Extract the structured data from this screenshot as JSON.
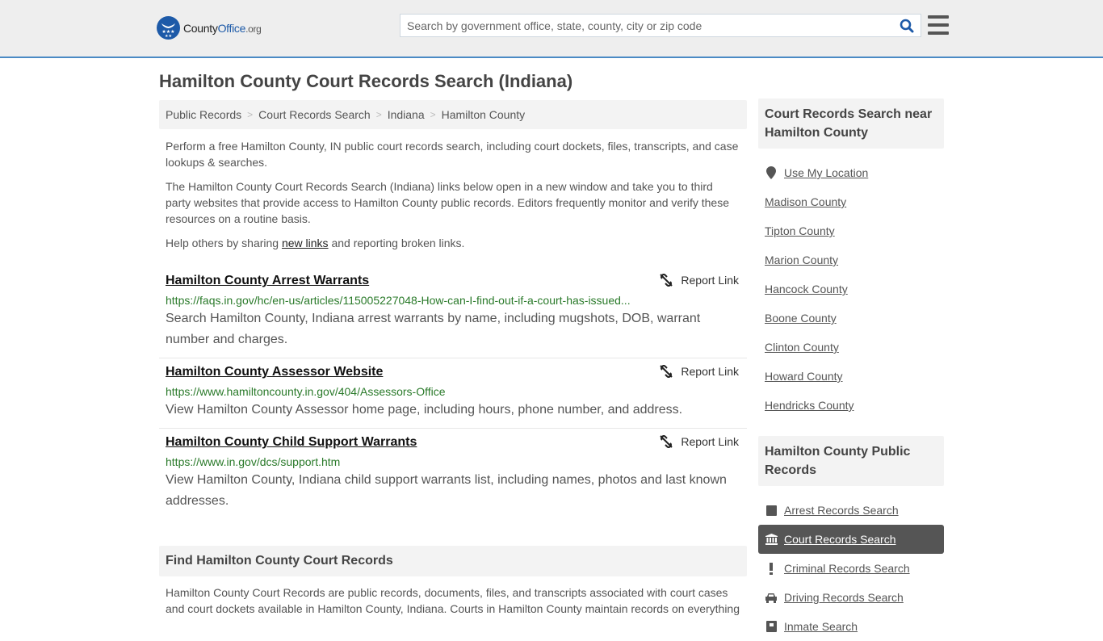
{
  "header": {
    "logo": {
      "name_part1": "County",
      "name_part2": "Office",
      "tld": ".org"
    },
    "search": {
      "placeholder": "Search by government office, state, county, city or zip code",
      "value": ""
    },
    "accent_color": "#1d5aa8"
  },
  "page_title": "Hamilton County Court Records Search (Indiana)",
  "breadcrumb": [
    "Public Records",
    "Court Records Search",
    "Indiana",
    "Hamilton County"
  ],
  "intro": {
    "p1": "Perform a free Hamilton County, IN public court records search, including court dockets, files, transcripts, and case lookups & searches.",
    "p2": "The Hamilton County Court Records Search (Indiana) links below open in a new window and take you to third party websites that provide access to Hamilton County public records. Editors frequently monitor and verify these resources on a routine basis.",
    "p3_before": "Help others by sharing ",
    "p3_link": "new links",
    "p3_after": " and reporting broken links."
  },
  "report_label": "Report Link",
  "links": [
    {
      "title": "Hamilton County Arrest Warrants",
      "url": "https://faqs.in.gov/hc/en-us/articles/115005227048-How-can-I-find-out-if-a-court-has-issued...",
      "description": "Search Hamilton County, Indiana arrest warrants by name, including mugshots, DOB, warrant number and charges."
    },
    {
      "title": "Hamilton County Assessor Website",
      "url": "https://www.hamiltoncounty.in.gov/404/Assessors-Office",
      "description": "View Hamilton County Assessor home page, including hours, phone number, and address."
    },
    {
      "title": "Hamilton County Child Support Warrants",
      "url": "https://www.in.gov/dcs/support.htm",
      "description": "View Hamilton County, Indiana child support warrants list, including names, photos and last known addresses."
    }
  ],
  "find": {
    "heading": "Find Hamilton County Court Records",
    "body": "Hamilton County Court Records are public records, documents, files, and transcripts associated with court cases and court dockets available in Hamilton County, Indiana. Courts in Hamilton County maintain records on everything"
  },
  "sidebar": {
    "nearby": {
      "heading": "Court Records Search near Hamilton County",
      "use_location": "Use My Location",
      "counties": [
        "Madison County",
        "Tipton County",
        "Marion County",
        "Hancock County",
        "Boone County",
        "Clinton County",
        "Howard County",
        "Hendricks County"
      ]
    },
    "public_records": {
      "heading": "Hamilton County Public Records",
      "items": [
        {
          "label": "Arrest Records Search",
          "icon": "square-icon",
          "active": false
        },
        {
          "label": "Court Records Search",
          "icon": "courthouse-icon",
          "active": true
        },
        {
          "label": "Criminal Records Search",
          "icon": "exclamation-icon",
          "active": false
        },
        {
          "label": "Driving Records Search",
          "icon": "car-icon",
          "active": false
        },
        {
          "label": "Inmate Search",
          "icon": "inmate-icon",
          "active": false
        }
      ]
    }
  }
}
